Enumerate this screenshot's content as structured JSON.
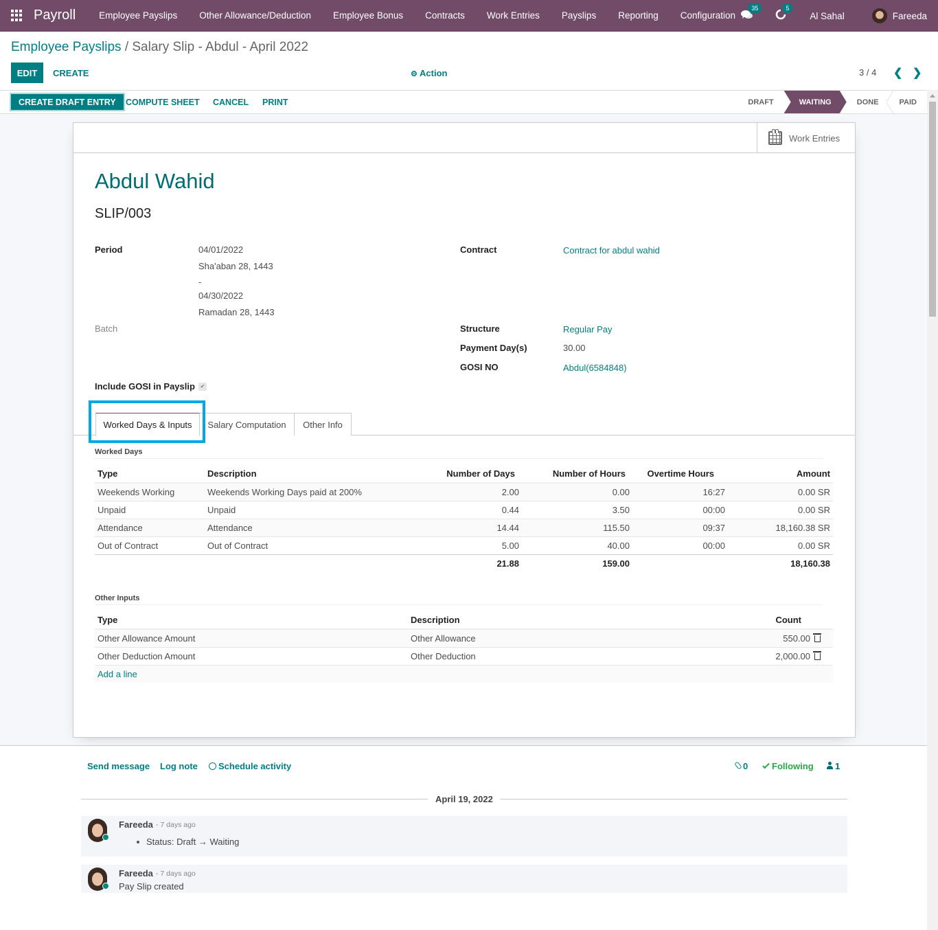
{
  "navbar": {
    "app_name": "Payroll",
    "menu": [
      "Employee Payslips",
      "Other Allowance/Deduction",
      "Employee Bonus",
      "Contracts",
      "Work Entries",
      "Payslips",
      "Reporting",
      "Configuration"
    ],
    "messages_count": "35",
    "activities_count": "5",
    "company": "Al Sahal",
    "user": "Fareeda"
  },
  "breadcrumb": {
    "parent": "Employee Payslips",
    "separator": "/",
    "current": "Salary Slip - Abdul - April 2022"
  },
  "control": {
    "edit": "EDIT",
    "create": "CREATE",
    "action": "Action",
    "pager": "3 / 4"
  },
  "statusbar": {
    "buttons": [
      "CREATE DRAFT ENTRY",
      "COMPUTE SHEET",
      "CANCEL",
      "PRINT"
    ],
    "stages": [
      "DRAFT",
      "WAITING",
      "DONE",
      "PAID"
    ],
    "active_stage": "WAITING"
  },
  "smart_button": {
    "label": "Work Entries"
  },
  "form": {
    "employee_name": "Abdul Wahid",
    "reference": "SLIP/003",
    "period_label": "Period",
    "period_start": "04/01/2022",
    "period_start_hijri": "Sha'aban 28, 1443",
    "period_sep": "-",
    "period_end": "04/30/2022",
    "period_end_hijri": "Ramadan 28, 1443",
    "batch_label": "Batch",
    "contract_label": "Contract",
    "contract_value": "Contract for abdul wahid",
    "structure_label": "Structure",
    "structure_value": "Regular Pay",
    "payment_days_label": "Payment Day(s)",
    "payment_days_value": "30.00",
    "gosi_label": "GOSI NO",
    "gosi_value": "Abdul(6584848)",
    "include_gosi_label": "Include GOSI in Payslip",
    "include_gosi_checked": true
  },
  "tabs": [
    "Worked Days & Inputs",
    "Salary Computation",
    "Other Info"
  ],
  "worked_days": {
    "title": "Worked Days",
    "columns": [
      "Type",
      "Description",
      "Number of Days",
      "Number of Hours",
      "Overtime Hours",
      "Amount"
    ],
    "rows": [
      [
        "Weekends Working",
        "Weekends Working Days paid at 200%",
        "2.00",
        "0.00",
        "16:27",
        "0.00 SR"
      ],
      [
        "Unpaid",
        "Unpaid",
        "0.44",
        "3.50",
        "00:00",
        "0.00 SR"
      ],
      [
        "Attendance",
        "Attendance",
        "14.44",
        "115.50",
        "09:37",
        "18,160.38 SR"
      ],
      [
        "Out of Contract",
        "Out of Contract",
        "5.00",
        "40.00",
        "00:00",
        "0.00 SR"
      ]
    ],
    "totals": {
      "days": "21.88",
      "hours": "159.00",
      "amount": "18,160.38"
    }
  },
  "other_inputs": {
    "title": "Other Inputs",
    "columns": [
      "Type",
      "Description",
      "Count"
    ],
    "rows": [
      [
        "Other Allowance Amount",
        "Other Allowance",
        "550.00"
      ],
      [
        "Other Deduction Amount",
        "Other Deduction",
        "2,000.00"
      ]
    ],
    "add_line": "Add a line"
  },
  "chatter": {
    "send_message": "Send message",
    "log_note": "Log note",
    "schedule_activity": "Schedule activity",
    "attachments": "0",
    "following": "Following",
    "followers": "1",
    "date_separator": "April 19, 2022",
    "messages": [
      {
        "author": "Fareeda",
        "date": "- 7 days ago",
        "body_prefix": "Status: Draft",
        "body_arrow": "→",
        "body_suffix": "Waiting"
      },
      {
        "author": "Fareeda",
        "date": "- 7 days ago",
        "body": "Pay Slip created"
      }
    ]
  },
  "colors": {
    "brand": "#714b67",
    "primary": "#017e84",
    "highlight": "#00a8e6",
    "following": "#28a745"
  }
}
